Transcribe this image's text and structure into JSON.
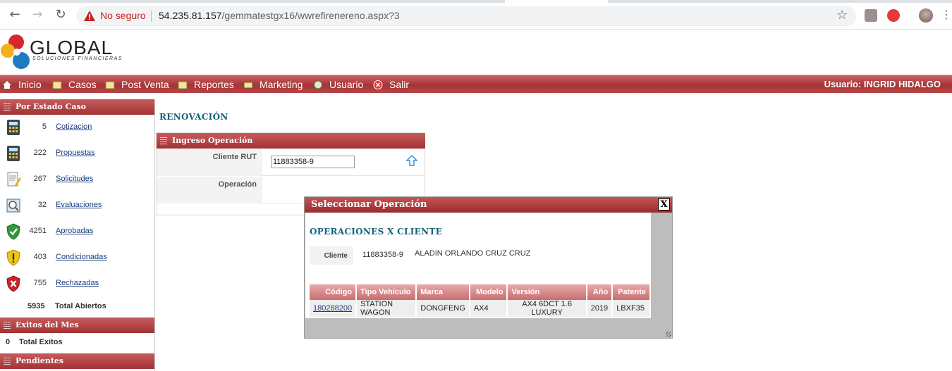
{
  "browser": {
    "security_label": "No seguro",
    "url_host": "54.235.81.157",
    "url_path": "/gemmatestgx16/wwrefirenereno.aspx?3"
  },
  "logo": {
    "name": "GLOBAL",
    "tagline": "SOLUCIONES FINANCIERAS"
  },
  "menu": {
    "items": [
      {
        "label": "Inicio",
        "icon": "home-icon"
      },
      {
        "label": "Casos",
        "icon": "folder-icon"
      },
      {
        "label": "Post Venta",
        "icon": "folder-icon"
      },
      {
        "label": "Reportes",
        "icon": "folder-icon"
      },
      {
        "label": "Marketing",
        "icon": "mail-icon"
      },
      {
        "label": "Usuario",
        "icon": "user-icon"
      },
      {
        "label": "Salir",
        "icon": "exit-icon"
      }
    ],
    "user": "Usuario:  INGRID HIDALGO"
  },
  "sidebar": {
    "by_state_title": "Por Estado Caso",
    "states": [
      {
        "count": "5",
        "label": "Cotizacion",
        "icon": "calculator-icon"
      },
      {
        "count": "222",
        "label": "Propuestas",
        "icon": "calculator-icon"
      },
      {
        "count": "267",
        "label": "Solicitudes",
        "icon": "document-pencil-icon"
      },
      {
        "count": "32",
        "label": "Evaluaciones",
        "icon": "magnifier-document-icon"
      },
      {
        "count": "4251",
        "label": "Aprobadas",
        "icon": "green-shield-check-icon"
      },
      {
        "count": "403",
        "label": "Condicionadas",
        "icon": "yellow-shield-warning-icon"
      },
      {
        "count": "755",
        "label": "Rechazadas",
        "icon": "red-shield-x-icon"
      }
    ],
    "total_open_count": "5935",
    "total_open_label": "Total Abiertos",
    "success_title": "Exitos del Mes",
    "success_count": "0",
    "success_label": "Total Exitos",
    "pending_title": "Pendientes"
  },
  "main": {
    "page_title": "RENOVACIÓN",
    "form_title": "Ingreso Operación",
    "client_rut_label": "Cliente RUT",
    "client_rut_value": "11883358-9",
    "operation_label": "Operación"
  },
  "modal": {
    "title": "Seleccionar Operación",
    "close": "X",
    "section_title": "OPERACIONES X CLIENTE",
    "client_label": "Cliente",
    "client_rut": "11883358-9",
    "client_name": "ALADIN ORLANDO CRUZ CRUZ",
    "columns": [
      "Código",
      "Tipo Vehículo",
      "Marca",
      "Modelo",
      "Versión",
      "Año",
      "Patente"
    ],
    "rows": [
      [
        "180288200",
        "STATION WAGON",
        "DONGFENG",
        "AX4",
        "AX4 6DCT 1.6 LUXURY",
        "2019",
        "LBXF35"
      ]
    ]
  },
  "colors": {
    "menu_red": "#a73435",
    "title_teal": "#15637a",
    "link_blue": "#1a3d7c"
  }
}
